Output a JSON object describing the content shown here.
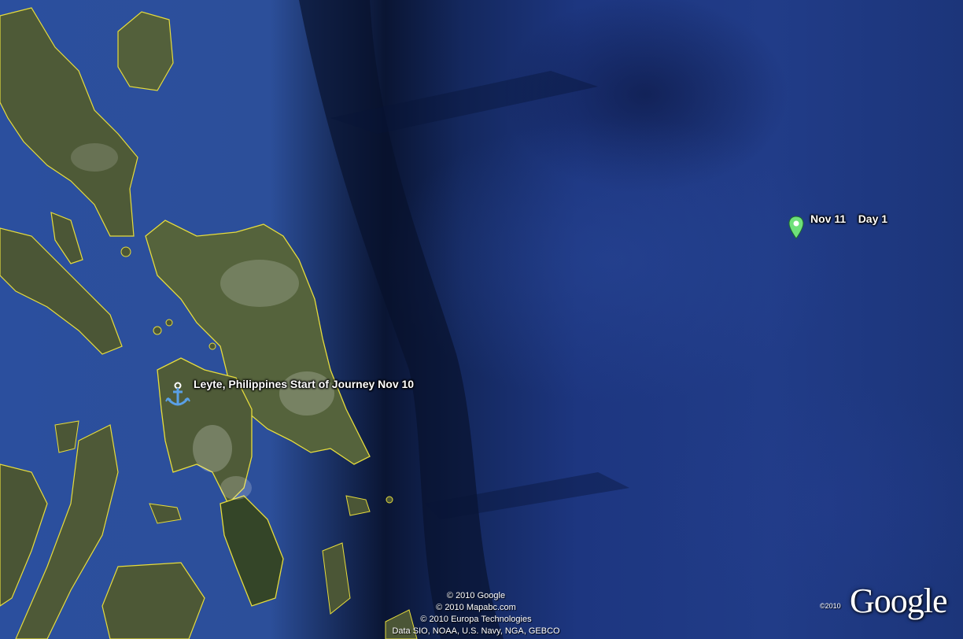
{
  "map": {
    "placemarks": [
      {
        "label": "Leyte, Philippines   Start of Journey Nov 10",
        "icon": "anchor-icon",
        "color": "#5aa0e6"
      },
      {
        "label": "Nov 11    Day 1",
        "icon": "green-pin-icon",
        "color": "#6fe07a"
      }
    ],
    "attribution": [
      "© 2010 Google",
      "© 2010 Mapabc.com",
      "© 2010 Europa Technologies",
      "Data SIO, NOAA, U.S. Navy, NGA, GEBCO"
    ],
    "copyright_year": "©2010",
    "logo": "Google",
    "colors": {
      "ocean": "#213c88",
      "land": "#4f5a36",
      "border": "#e6dc3c"
    }
  }
}
